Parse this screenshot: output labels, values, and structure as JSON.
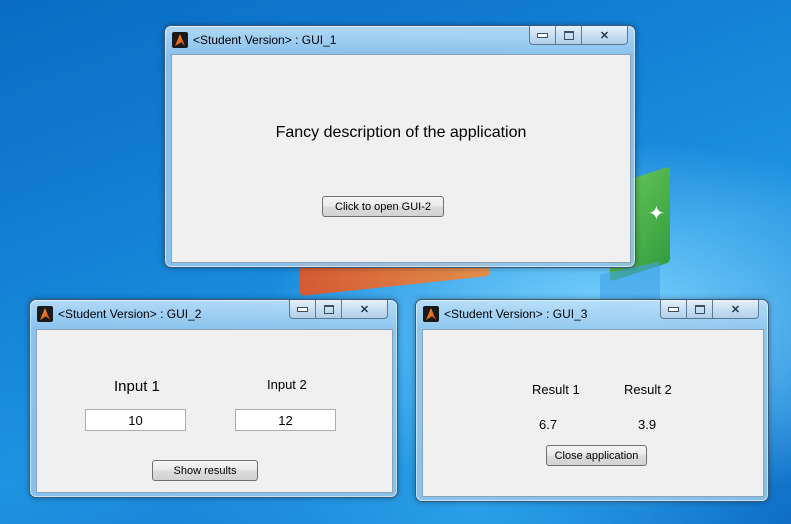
{
  "gui1": {
    "title": "<Student Version> : GUI_1",
    "description": "Fancy description of the application",
    "open_button": "Click to open GUI-2"
  },
  "gui2": {
    "title": "<Student Version> : GUI_2",
    "input1_label": "Input 1",
    "input2_label": "Input 2",
    "input1_value": "10",
    "input2_value": "12",
    "show_button": "Show results"
  },
  "gui3": {
    "title": "<Student Version> : GUI_3",
    "result1_label": "Result 1",
    "result2_label": "Result 2",
    "result1_value": "6.7",
    "result2_value": "3.9",
    "close_button": "Close application"
  },
  "icons": {
    "window_icon": "matlab-icon",
    "minimize": "minimize-icon",
    "maximize": "maximize-icon",
    "close": "close-icon"
  }
}
